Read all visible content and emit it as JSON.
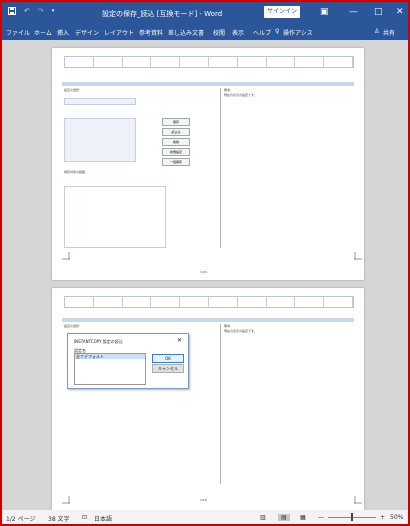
{
  "window": {
    "title": "設定の保存_読込 [互換モード] - Word",
    "signin_label": "サインイン",
    "minimize_glyph": "—",
    "maximize_glyph": "□",
    "close_glyph": "✕",
    "accent_color": "#2b579a"
  },
  "qat": {
    "save_icon": "save-icon",
    "undo_icon": "undo-icon",
    "redo_icon": "redo-icon",
    "customize_icon": "chevron-down-icon"
  },
  "ribbon": {
    "tabs": [
      "ファイル",
      "ホーム",
      "挿入",
      "デザイン",
      "レイアウト",
      "参考資料",
      "差し込み文書",
      "校閲",
      "表示",
      "ヘルプ"
    ],
    "tell_me": "操作アシス",
    "share": "共有"
  },
  "page1": {
    "field_label": "設定の選択：",
    "memo_label": "備考：",
    "memo_text": "現在の表示の設定です。",
    "buttons": [
      "保存",
      "読込み",
      "削除",
      "新規設定",
      "一括保存"
    ],
    "options_label": "保存対象の範囲",
    "footer_text": "1/16"
  },
  "page2": {
    "field_label": "設定の選択：",
    "memo_label": "備考：",
    "memo_text": "現在の表示の設定です。",
    "footer_text": "1/16"
  },
  "dialog": {
    "title": "INSTANTCOPY 設定の読込",
    "close_glyph": "✕",
    "list_label": "設定名",
    "list_items": [
      "全てデフォルト"
    ],
    "ok_label": "OK",
    "cancel_label": "キャンセル"
  },
  "statusbar": {
    "page_info": "1/2 ページ",
    "word_count": "38 文字",
    "language": "日本語",
    "zoom_level": "50%",
    "zoom_fraction": 0.5
  }
}
